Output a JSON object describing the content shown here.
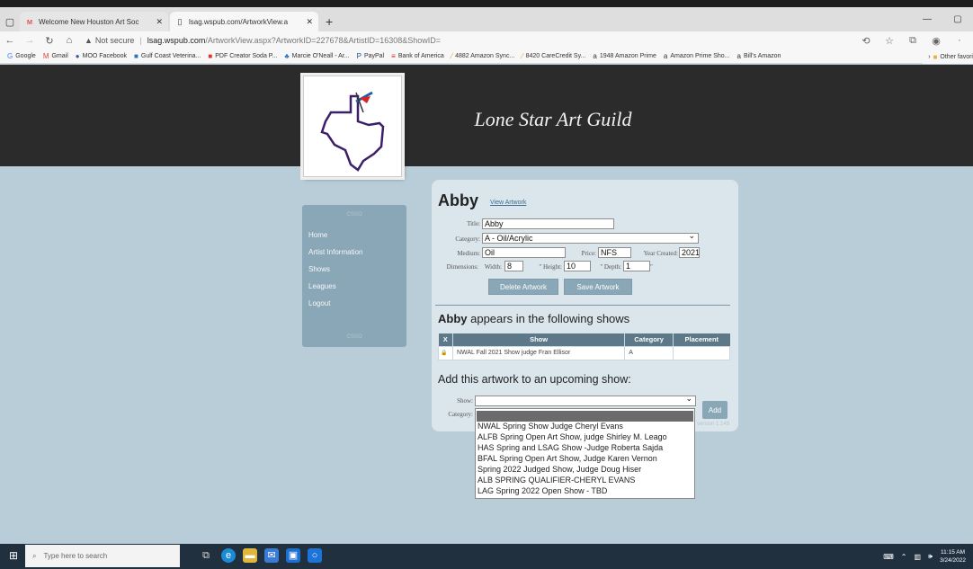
{
  "browser": {
    "tabs": [
      {
        "title": "Welcome New Houston Art Soc",
        "icon": "member-planet-icon"
      },
      {
        "title": "lsag.wspub.com/ArtworkView.a",
        "icon": "page-icon"
      }
    ],
    "security": "Not secure",
    "url_host": "lsag.wspub.com",
    "url_path": "/ArtworkView.aspx?ArtworkID=227678&ArtistID=16308&ShowID=",
    "bookmarks": [
      "Google",
      "Gmail",
      "MOO Facebook",
      "Gulf Coast Veterina...",
      "PDF Creator Soda P...",
      "Marcie O'Neall - Ar...",
      "PayPal",
      "Bank of America",
      "4882 Amazon Sync...",
      "8420 CareCredit Sy...",
      "1948 Amazon Prime",
      "Amazon Prime Sho...",
      "Bill's Amazon"
    ],
    "other_favorites": "Other favori"
  },
  "site": {
    "title": "Lone Star Art Guild"
  },
  "sidebar": {
    "deco_top": "CSSO",
    "deco_bottom": "CSSO",
    "items": [
      "Home",
      "Artist Information",
      "Shows",
      "Leagues",
      "Logout"
    ]
  },
  "artwork": {
    "title": "Abby",
    "view_link": "View Artwork",
    "labels": {
      "title": "Title:",
      "category": "Category:",
      "medium": "Medium:",
      "price": "Price:",
      "year": "Year Created:",
      "dimensions": "Dimensions:",
      "width": "Width:",
      "height": "\" Height:",
      "depth": "\" Depth:"
    },
    "values": {
      "title": "Abby",
      "category": "A - Oil/Acrylic",
      "medium": "Oil",
      "price": "NFS",
      "year": "2021",
      "width": "8",
      "height": "10",
      "depth": "1"
    },
    "delete_label": "Delete Artwork",
    "save_label": "Save Artwork"
  },
  "shows_section": {
    "heading_strong": "Abby",
    "heading_rest": " appears in the following shows",
    "columns": [
      "X",
      "Show",
      "Category",
      "Placement"
    ],
    "rows": [
      {
        "lock": "🔒",
        "show": "NWAL Fall 2021 Show judge Fran Ellisor",
        "category": "A",
        "placement": ""
      }
    ]
  },
  "add_section": {
    "heading": "Add this artwork to an upcoming show:",
    "show_label": "Show:",
    "category_label": "Category:",
    "add_label": "Add",
    "faded_text": "version 1.149",
    "options": [
      "NWAL Spring Show Judge Cheryl Evans",
      "ALFB Spring Open Art Show, judge Shirley M. Leago",
      "HAS Spring and LSAG Show -Judge Roberta Sajda",
      "BFAL Spring Open Art Show, Judge Karen Vernon",
      "Spring 2022 Judged Show, Judge Doug Hiser",
      "ALB SPRING QUALIFIER-CHERYL EVANS",
      "LAG Spring 2022 Open Show - TBD"
    ]
  },
  "taskbar": {
    "search_placeholder": "Type here to search",
    "time": "11:15 AM",
    "date": "3/24/2022"
  }
}
